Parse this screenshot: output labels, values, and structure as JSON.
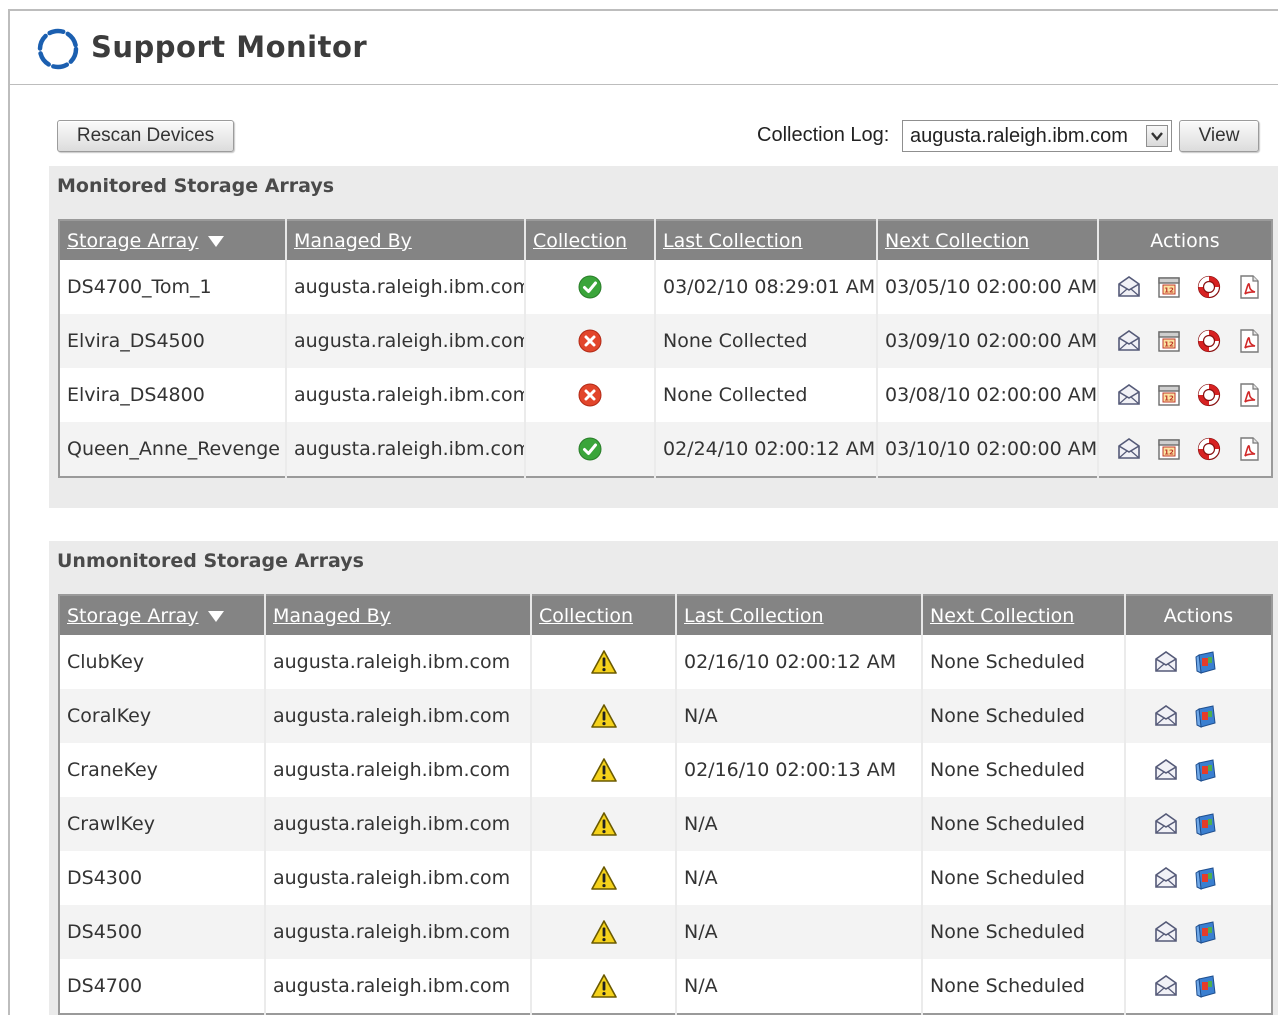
{
  "app": {
    "title": "Support Monitor"
  },
  "toolbar": {
    "rescan_label": "Rescan Devices",
    "collection_log_label": "Collection Log:",
    "collection_log_value": "augusta.raleigh.ibm.com",
    "view_label": "View"
  },
  "monitored": {
    "title": "Monitored Storage Arrays",
    "columns": [
      "Storage Array",
      "Managed By",
      "Collection",
      "Last Collection",
      "Next Collection",
      "Actions"
    ],
    "rows": [
      {
        "array": "DS4700_Tom_1",
        "managed_by": "augusta.raleigh.ibm.com",
        "collection": "success",
        "last": "03/02/10 08:29:01 AM",
        "next": "03/05/10 02:00:00 AM"
      },
      {
        "array": "Elvira_DS4500",
        "managed_by": "augusta.raleigh.ibm.com",
        "collection": "failed",
        "last": "None Collected",
        "next": "03/09/10 02:00:00 AM"
      },
      {
        "array": "Elvira_DS4800",
        "managed_by": "augusta.raleigh.ibm.com",
        "collection": "failed",
        "last": "None Collected",
        "next": "03/08/10 02:00:00 AM"
      },
      {
        "array": "Queen_Anne_Revenge",
        "managed_by": "augusta.raleigh.ibm.com",
        "collection": "success",
        "last": "02/24/10 02:00:12 AM",
        "next": "03/10/10 02:00:00 AM"
      }
    ],
    "action_icons": [
      "email-icon",
      "calendar-icon",
      "lifebuoy-icon",
      "pdf-document-icon"
    ]
  },
  "unmonitored": {
    "title": "Unmonitored Storage Arrays",
    "columns": [
      "Storage Array",
      "Managed By",
      "Collection",
      "Last Collection",
      "Next Collection",
      "Actions"
    ],
    "rows": [
      {
        "array": "ClubKey",
        "managed_by": "augusta.raleigh.ibm.com",
        "collection": "warning",
        "last": "02/16/10 02:00:12 AM",
        "next": "None Scheduled"
      },
      {
        "array": "CoralKey",
        "managed_by": "augusta.raleigh.ibm.com",
        "collection": "warning",
        "last": "N/A",
        "next": "None Scheduled"
      },
      {
        "array": "CraneKey",
        "managed_by": "augusta.raleigh.ibm.com",
        "collection": "warning",
        "last": "02/16/10 02:00:13 AM",
        "next": "None Scheduled"
      },
      {
        "array": "CrawlKey",
        "managed_by": "augusta.raleigh.ibm.com",
        "collection": "warning",
        "last": "N/A",
        "next": "None Scheduled"
      },
      {
        "array": "DS4300",
        "managed_by": "augusta.raleigh.ibm.com",
        "collection": "warning",
        "last": "N/A",
        "next": "None Scheduled"
      },
      {
        "array": "DS4500",
        "managed_by": "augusta.raleigh.ibm.com",
        "collection": "warning",
        "last": "N/A",
        "next": "None Scheduled"
      },
      {
        "array": "DS4700",
        "managed_by": "augusta.raleigh.ibm.com",
        "collection": "warning",
        "last": "N/A",
        "next": "None Scheduled"
      }
    ],
    "action_icons": [
      "email-icon",
      "storage-device-icon"
    ]
  },
  "colors": {
    "header_bg": "#848484",
    "panel_bg": "#ebebeb",
    "success": "#3aa53a",
    "error": "#e2452b",
    "warning": "#f5d21b",
    "logo_blue": "#1b5fb0"
  }
}
